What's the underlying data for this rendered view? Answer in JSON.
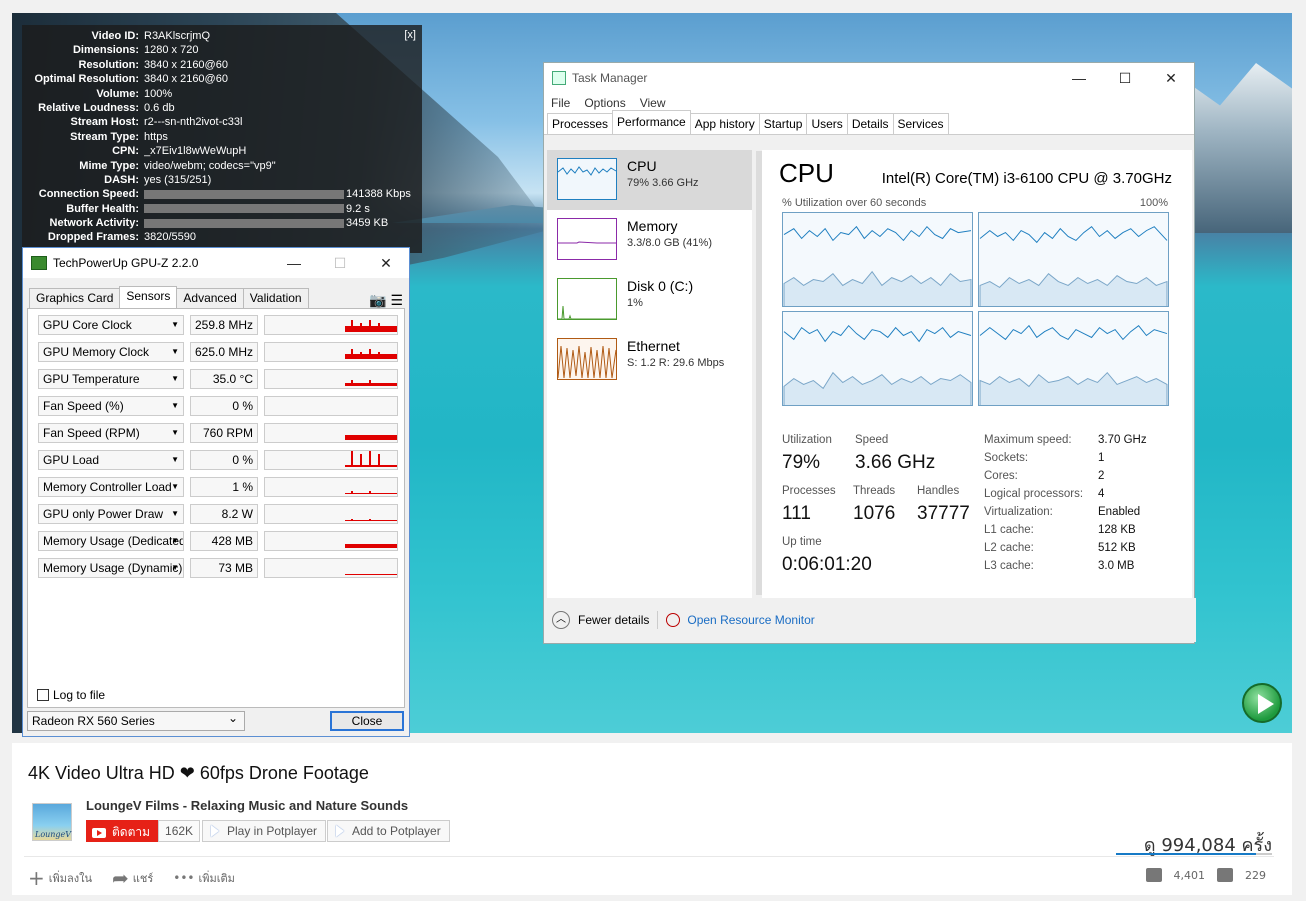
{
  "stats": {
    "close": "[x]",
    "rows": [
      {
        "k": "Video ID:",
        "v": "R3AKlscrjmQ"
      },
      {
        "k": "Dimensions:",
        "v": "1280 x 720"
      },
      {
        "k": "Resolution:",
        "v": "3840 x 2160@60"
      },
      {
        "k": "Optimal Resolution:",
        "v": "3840 x 2160@60"
      },
      {
        "k": "Volume:",
        "v": "100%"
      },
      {
        "k": "Relative Loudness:",
        "v": "0.6 db"
      },
      {
        "k": "Stream Host:",
        "v": "r2---sn-nth2ivot-c33l"
      },
      {
        "k": "Stream Type:",
        "v": "https"
      },
      {
        "k": "CPN:",
        "v": "_x7Eiv1l8wWeWupH"
      },
      {
        "k": "Mime Type:",
        "v": "video/webm; codecs=\"vp9\""
      },
      {
        "k": "DASH:",
        "v": "yes (315/251)"
      },
      {
        "k": "Connection Speed:",
        "v": "141388 Kbps"
      },
      {
        "k": "Buffer Health:",
        "v": "9.2 s"
      },
      {
        "k": "Network Activity:",
        "v": "3459 KB"
      },
      {
        "k": "Dropped Frames:",
        "v": "3820/5590"
      }
    ]
  },
  "gpuz": {
    "title": "TechPowerUp GPU-Z 2.2.0",
    "tabs": [
      "Graphics Card",
      "Sensors",
      "Advanced",
      "Validation"
    ],
    "sensors": [
      {
        "name": "GPU Core Clock",
        "value": "259.8 MHz"
      },
      {
        "name": "GPU Memory Clock",
        "value": "625.0 MHz"
      },
      {
        "name": "GPU Temperature",
        "value": "35.0 °C"
      },
      {
        "name": "Fan Speed (%)",
        "value": "0 %"
      },
      {
        "name": "Fan Speed (RPM)",
        "value": "760 RPM"
      },
      {
        "name": "GPU Load",
        "value": "0 %"
      },
      {
        "name": "Memory Controller Load",
        "value": "1 %"
      },
      {
        "name": "GPU only Power Draw",
        "value": "8.2 W"
      },
      {
        "name": "Memory Usage (Dedicated)",
        "value": "428 MB"
      },
      {
        "name": "Memory Usage (Dynamic)",
        "value": "73 MB"
      }
    ],
    "log_label": "Log to file",
    "device": "Radeon RX 560 Series",
    "close_label": "Close"
  },
  "tm": {
    "title": "Task Manager",
    "menu": [
      "File",
      "Options",
      "View"
    ],
    "tabs": [
      "Processes",
      "Performance",
      "App history",
      "Startup",
      "Users",
      "Details",
      "Services"
    ],
    "resources": [
      {
        "name": "CPU",
        "sub": "79%  3.66 GHz",
        "color": "#1f7fc0"
      },
      {
        "name": "Memory",
        "sub": "3.3/8.0 GB (41%)",
        "color": "#8b2aa8"
      },
      {
        "name": "Disk 0 (C:)",
        "sub": "1%",
        "color": "#4a9a2e"
      },
      {
        "name": "Ethernet",
        "sub": "S: 1.2  R: 29.6 Mbps",
        "color": "#b05a14"
      }
    ],
    "cpu_title": "CPU",
    "cpu_model": "Intel(R) Core(TM) i3-6100 CPU @ 3.70GHz",
    "util_label": "% Utilization over 60 seconds",
    "util_max": "100%",
    "stats": {
      "utilization_label": "Utilization",
      "utilization": "79%",
      "speed_label": "Speed",
      "speed": "3.66 GHz",
      "processes_label": "Processes",
      "processes": "111",
      "threads_label": "Threads",
      "threads": "1076",
      "handles_label": "Handles",
      "handles": "37777",
      "uptime_label": "Up time",
      "uptime": "0:06:01:20"
    },
    "specs": [
      {
        "k": "Maximum speed:",
        "v": "3.70 GHz"
      },
      {
        "k": "Sockets:",
        "v": "1"
      },
      {
        "k": "Cores:",
        "v": "2"
      },
      {
        "k": "Logical processors:",
        "v": "4"
      },
      {
        "k": "Virtualization:",
        "v": "Enabled"
      },
      {
        "k": "L1 cache:",
        "v": "128 KB"
      },
      {
        "k": "L2 cache:",
        "v": "512 KB"
      },
      {
        "k": "L3 cache:",
        "v": "3.0 MB"
      }
    ],
    "fewer": "Fewer details",
    "resmon": "Open Resource Monitor"
  },
  "video": {
    "title": "4K Video Ultra HD ❤ 60fps Drone Footage",
    "channel": "LoungeV Films - Relaxing Music and Nature Sounds",
    "channel_logo_text": "LoungeV",
    "subscribe": "ติดตาม",
    "sub_count": "162K",
    "play_potplayer": "Play in Potplayer",
    "add_potplayer": "Add to Potplayer",
    "views": "ดู 994,084 ครั้ง",
    "add_to": "เพิ่มลงใน",
    "share": "แชร์",
    "more": "เพิ่มเติม",
    "likes": "4,401",
    "dislikes": "229"
  }
}
